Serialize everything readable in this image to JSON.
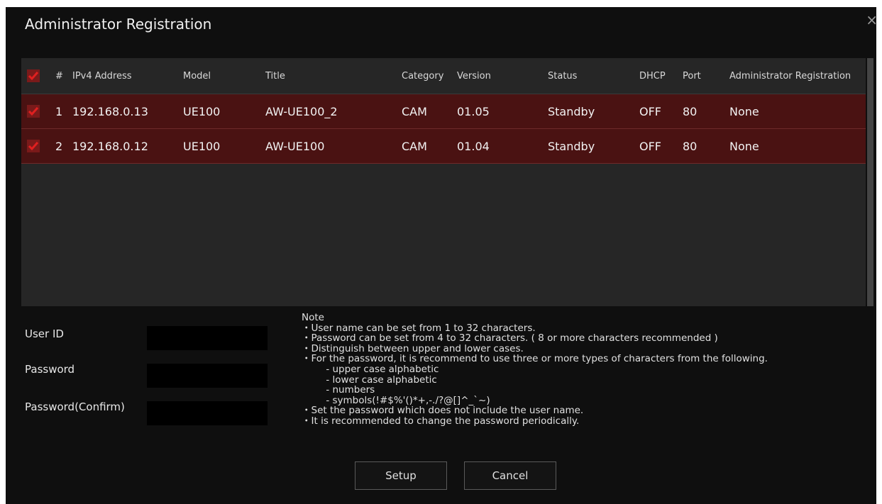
{
  "dialog": {
    "title": "Administrator Registration",
    "close": "×"
  },
  "table": {
    "headers": {
      "num": "#",
      "ip": "IPv4 Address",
      "model": "Model",
      "title": "Title",
      "category": "Category",
      "version": "Version",
      "status": "Status",
      "dhcp": "DHCP",
      "port": "Port",
      "admin": "Administrator Registration"
    },
    "rows": [
      {
        "checked": true,
        "num": "1",
        "ip": "192.168.0.13",
        "model": "UE100",
        "title": "AW-UE100_2",
        "category": "CAM",
        "version": "01.05",
        "status": "Standby",
        "dhcp": "OFF",
        "port": "80",
        "admin": "None"
      },
      {
        "checked": true,
        "num": "2",
        "ip": "192.168.0.12",
        "model": "UE100",
        "title": "AW-UE100",
        "category": "CAM",
        "version": "01.04",
        "status": "Standby",
        "dhcp": "OFF",
        "port": "80",
        "admin": "None"
      }
    ]
  },
  "form": {
    "user_id_label": "User ID",
    "password_label": "Password",
    "password_confirm_label": "Password(Confirm)",
    "user_id_value": "",
    "password_value": "",
    "password_confirm_value": ""
  },
  "note": {
    "heading": "Note",
    "lines": [
      "・User name can be set from 1 to 32 characters.",
      "・Password can be set from 4 to 32 characters. ( 8 or more characters recommended )",
      "・Distinguish between upper and lower cases.",
      "・For the password, it is recommend to use three or more types of characters from the following.",
      "        - upper case alphabetic",
      "        - lower case alphabetic",
      "        - numbers",
      "        - symbols(!#$%'()*+,-./?@[]^_`~)",
      "・Set the password which does not include the user name.",
      "・It is recommended to change the password periodically."
    ]
  },
  "buttons": {
    "setup": "Setup",
    "cancel": "Cancel"
  },
  "colors": {
    "accent": "#cc1f1f",
    "row_bg": "#4a1212",
    "panel_bg": "#262626",
    "dialog_bg": "#0f0f0f"
  },
  "icons": {
    "checkbox": "checkmark-icon",
    "close": "close-icon"
  }
}
